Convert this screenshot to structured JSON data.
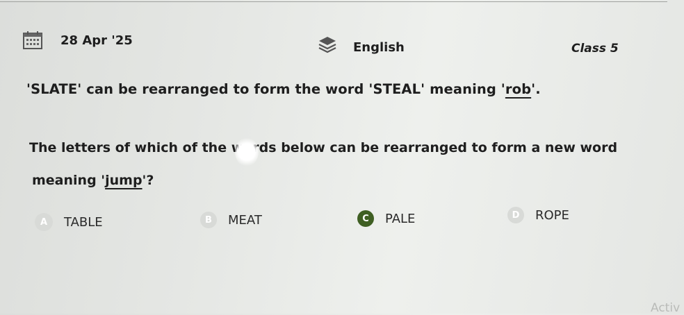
{
  "header": {
    "date": "28 Apr '25",
    "subject": "English",
    "class_label": "Class 5",
    "icons": [
      "calendar-icon",
      "layers-icon"
    ]
  },
  "question": {
    "example_before": "'SLATE' can be rearranged to form the word 'STEAL' meaning '",
    "example_word": "rob",
    "example_after": "'.",
    "prompt_line1": "The letters of which of the words below can be rearranged to form a new word",
    "prompt_before": "meaning '",
    "prompt_word": "jump",
    "prompt_after": "'?"
  },
  "options": [
    {
      "letter": "A",
      "text": "TABLE",
      "selected": false
    },
    {
      "letter": "B",
      "text": "MEAT",
      "selected": false
    },
    {
      "letter": "C",
      "text": "PALE",
      "selected": true
    },
    {
      "letter": "D",
      "text": "ROPE",
      "selected": false
    }
  ],
  "watermark": "Activ",
  "colors": {
    "selected_badge": "#3f5f23",
    "unselected_badge": "#d8dad7",
    "text": "#1e1e1e"
  }
}
